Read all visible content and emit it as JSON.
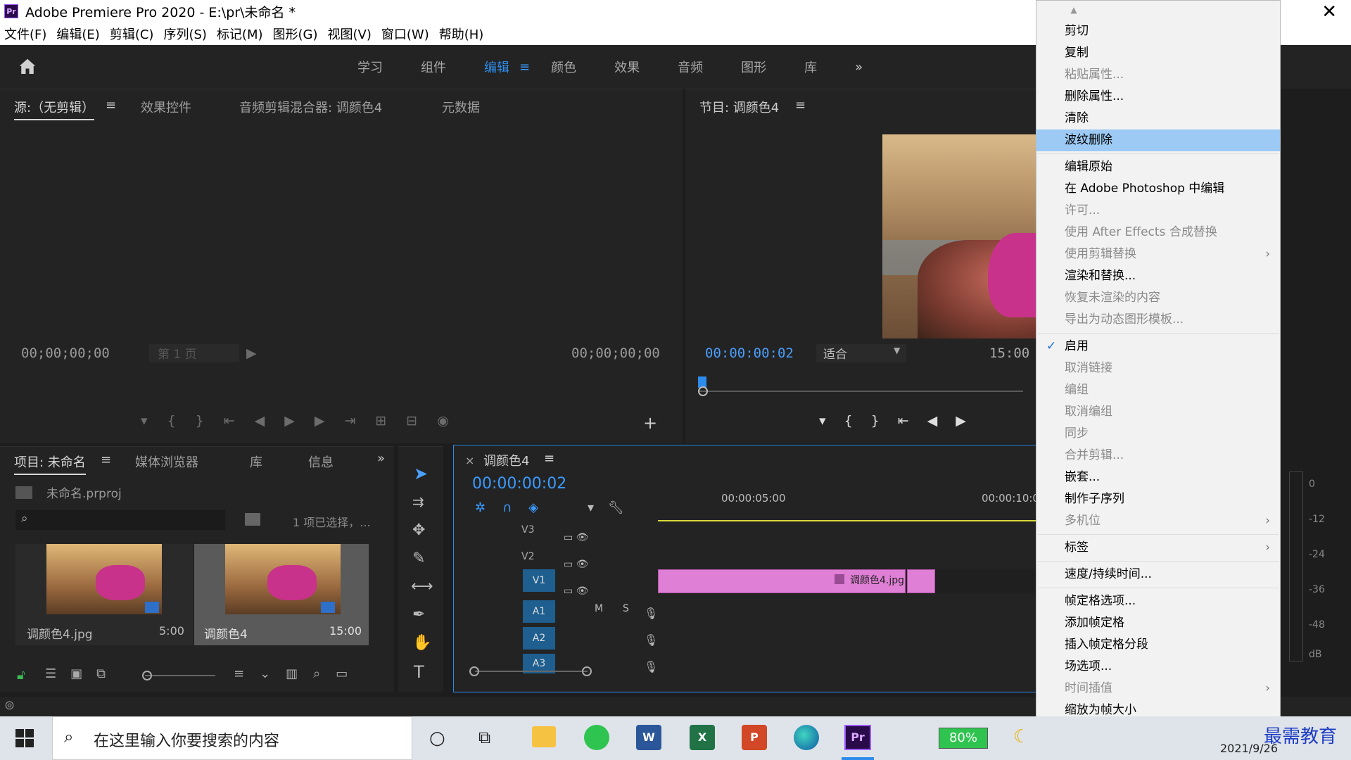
{
  "app": {
    "title": "Adobe Premiere Pro 2020 - E:\\pr\\未命名 *",
    "badge": "Pr"
  },
  "menubar": [
    "文件(F)",
    "编辑(E)",
    "剪辑(C)",
    "序列(S)",
    "标记(M)",
    "图形(G)",
    "视图(V)",
    "窗口(W)",
    "帮助(H)"
  ],
  "workspace": {
    "tabs": [
      "学习",
      "组件",
      "编辑",
      "颜色",
      "效果",
      "音频",
      "图形",
      "库"
    ],
    "active": "编辑"
  },
  "source": {
    "tabs": [
      "源:（无剪辑）",
      "效果控件",
      "音频剪辑混合器: 调颜色4",
      "元数据"
    ],
    "tc_left": "00;00;00;00",
    "tc_right": "00;00;00;00",
    "page": "第 1 页"
  },
  "program": {
    "title": "节目: 调颜色4",
    "tc": "00:00:00:02",
    "fit": "适合",
    "tc_right": "15:00"
  },
  "project": {
    "tabs": [
      "项目: 未命名",
      "媒体浏览器",
      "库",
      "信息"
    ],
    "file": "未命名.prproj",
    "selected": "1 项已选择，...",
    "items": [
      {
        "name": "调颜色4.jpg",
        "dur": "5:00"
      },
      {
        "name": "调颜色4",
        "dur": "15:00"
      }
    ]
  },
  "timeline": {
    "seq": "调颜色4",
    "tc": "00:00:00:02",
    "ruler": [
      "00:00:05:00",
      "00:00:10:0"
    ],
    "tracks": [
      "V3",
      "V2",
      "V1",
      "A1",
      "A2",
      "A3"
    ],
    "clip": "调颜色4.jpg",
    "m": "M",
    "s": "S"
  },
  "meter": {
    "labels": [
      "0",
      "-12",
      "-24",
      "-36",
      "-48",
      "dB"
    ]
  },
  "context_menu": [
    {
      "label": "剪切",
      "state": "normal"
    },
    {
      "label": "复制",
      "state": "normal"
    },
    {
      "label": "粘贴属性...",
      "state": "disabled"
    },
    {
      "label": "删除属性...",
      "state": "normal"
    },
    {
      "label": "清除",
      "state": "normal"
    },
    {
      "label": "波纹删除",
      "state": "highlight"
    },
    {
      "sep": true
    },
    {
      "label": "编辑原始",
      "state": "normal"
    },
    {
      "label": "在 Adobe Photoshop 中编辑",
      "state": "normal"
    },
    {
      "label": "许可...",
      "state": "disabled"
    },
    {
      "label": "使用 After Effects 合成替换",
      "state": "disabled"
    },
    {
      "label": "使用剪辑替换",
      "state": "disabled",
      "sub": true
    },
    {
      "label": "渲染和替换...",
      "state": "normal"
    },
    {
      "label": "恢复未渲染的内容",
      "state": "disabled"
    },
    {
      "label": "导出为动态图形模板...",
      "state": "disabled"
    },
    {
      "sep": true
    },
    {
      "label": "启用",
      "state": "normal",
      "check": true
    },
    {
      "label": "取消链接",
      "state": "disabled"
    },
    {
      "label": "编组",
      "state": "disabled"
    },
    {
      "label": "取消编组",
      "state": "disabled"
    },
    {
      "label": "同步",
      "state": "disabled"
    },
    {
      "label": "合并剪辑...",
      "state": "disabled"
    },
    {
      "label": "嵌套...",
      "state": "normal"
    },
    {
      "label": "制作子序列",
      "state": "normal"
    },
    {
      "label": "多机位",
      "state": "disabled",
      "sub": true
    },
    {
      "sep": true
    },
    {
      "label": "标签",
      "state": "normal",
      "sub": true
    },
    {
      "sep": true
    },
    {
      "label": "速度/持续时间...",
      "state": "normal"
    },
    {
      "sep": true
    },
    {
      "label": "帧定格选项...",
      "state": "normal"
    },
    {
      "label": "添加帧定格",
      "state": "normal"
    },
    {
      "label": "插入帧定格分段",
      "state": "normal"
    },
    {
      "label": "场选项...",
      "state": "normal"
    },
    {
      "label": "时间插值",
      "state": "disabled",
      "sub": true
    },
    {
      "label": "缩放为帧大小",
      "state": "normal"
    }
  ],
  "taskbar": {
    "search_placeholder": "在这里输入你要搜索的内容",
    "battery": "80%",
    "date": "2021/9/26",
    "watermark": "最需教育"
  },
  "colors": {
    "accent": "#2d8ceb",
    "clip": "#e07fd6",
    "highlight": "#9ccaf5"
  }
}
